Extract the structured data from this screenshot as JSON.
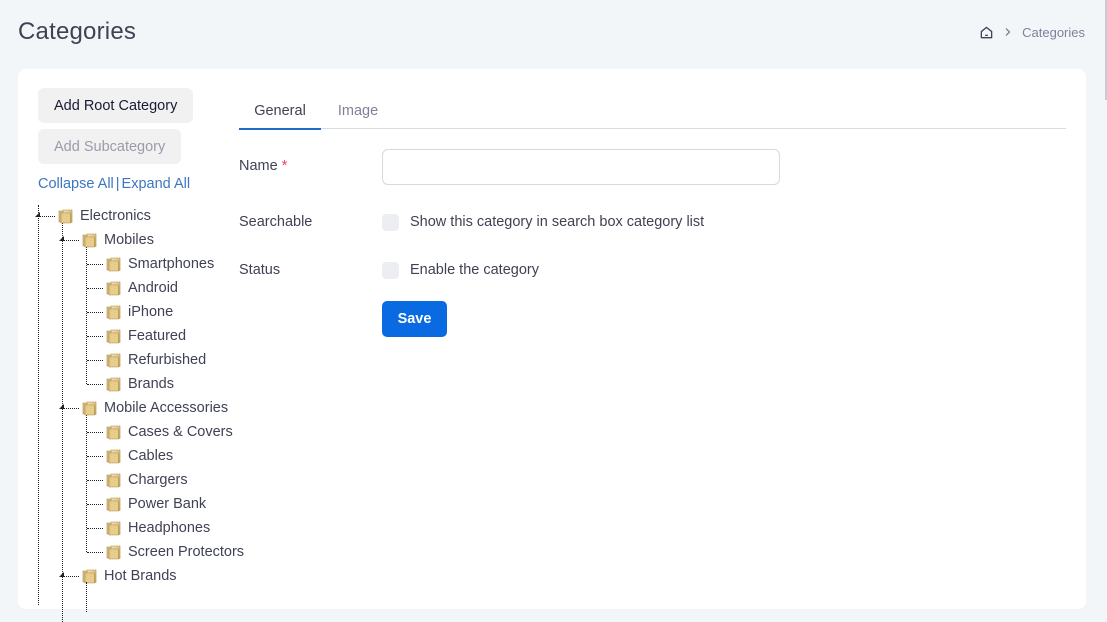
{
  "header": {
    "title": "Categories",
    "breadcrumb": {
      "home_icon": "home-icon",
      "separator_icon": "chevron-right-icon",
      "current": "Categories"
    }
  },
  "left_panel": {
    "add_root_label": "Add Root Category",
    "add_sub_label": "Add Subcategory",
    "collapse_all_label": "Collapse All",
    "separator": "|",
    "expand_all_label": "Expand All",
    "folder_icon": "folder-icon",
    "tree": [
      {
        "label": "Electronics",
        "level": 0,
        "expanded": true
      },
      {
        "label": "Mobiles",
        "level": 1,
        "expanded": true
      },
      {
        "label": "Smartphones",
        "level": 2
      },
      {
        "label": "Android",
        "level": 2
      },
      {
        "label": "iPhone",
        "level": 2
      },
      {
        "label": "Featured",
        "level": 2
      },
      {
        "label": "Refurbished",
        "level": 2
      },
      {
        "label": "Brands",
        "level": 2
      },
      {
        "label": "Mobile Accessories",
        "level": 1,
        "expanded": true
      },
      {
        "label": "Cases & Covers",
        "level": 2
      },
      {
        "label": "Cables",
        "level": 2
      },
      {
        "label": "Chargers",
        "level": 2
      },
      {
        "label": "Power Bank",
        "level": 2
      },
      {
        "label": "Headphones",
        "level": 2
      },
      {
        "label": "Screen Protectors",
        "level": 2
      },
      {
        "label": "Hot Brands",
        "level": 1,
        "expanded": true
      }
    ]
  },
  "form": {
    "tabs": [
      {
        "label": "General",
        "active": true
      },
      {
        "label": "Image",
        "active": false
      }
    ],
    "name": {
      "label": "Name",
      "required_mark": "*",
      "value": "",
      "placeholder": ""
    },
    "searchable": {
      "label": "Searchable",
      "checkbox_label": "Show this category in search box category list",
      "checked": false
    },
    "status": {
      "label": "Status",
      "checkbox_label": "Enable the category",
      "checked": false
    },
    "save_label": "Save"
  },
  "colors": {
    "primary": "#0a6ae1",
    "link": "#3e75c1",
    "required": "#f1416c",
    "background": "#f3f6f9"
  }
}
